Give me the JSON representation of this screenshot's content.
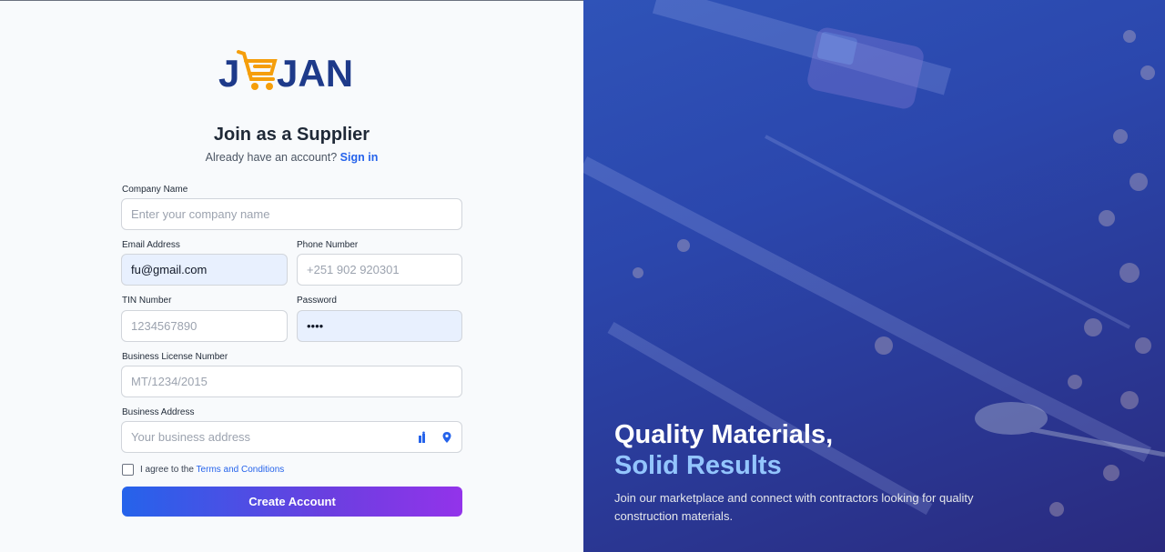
{
  "logo": {
    "text": "JEJAN",
    "accent": "#f59e0b",
    "brand": "#1e3a8a"
  },
  "form": {
    "title": "Join as a Supplier",
    "signin_prompt": "Already have an account?",
    "signin_link": "Sign in",
    "company_name": {
      "label": "Company Name",
      "placeholder": "Enter your company name",
      "value": ""
    },
    "email": {
      "label": "Email Address",
      "placeholder": "",
      "value": "fu@gmail.com"
    },
    "phone": {
      "label": "Phone Number",
      "placeholder": "+251 902 920301",
      "value": ""
    },
    "tin": {
      "label": "TIN Number",
      "placeholder": "1234567890",
      "value": ""
    },
    "password": {
      "label": "Password",
      "placeholder": "",
      "value": "••••"
    },
    "license": {
      "label": "Business License Number",
      "placeholder": "MT/1234/2015",
      "value": ""
    },
    "address": {
      "label": "Business Address",
      "placeholder": "Your business address",
      "value": "",
      "icons": [
        "password-manager-icon",
        "location-pin-icon"
      ]
    },
    "agree_prefix": "I agree to the",
    "terms_link": "Terms and Conditions",
    "submit_label": "Create Account"
  },
  "hero": {
    "title_line1": "Quality Materials,",
    "title_line2": "Solid Results",
    "description": "Join our marketplace and connect with contractors looking for quality construction materials."
  },
  "colors": {
    "primary": "#2563eb",
    "gradient_end": "#9333ea",
    "hero_accent": "#93c5fd"
  }
}
